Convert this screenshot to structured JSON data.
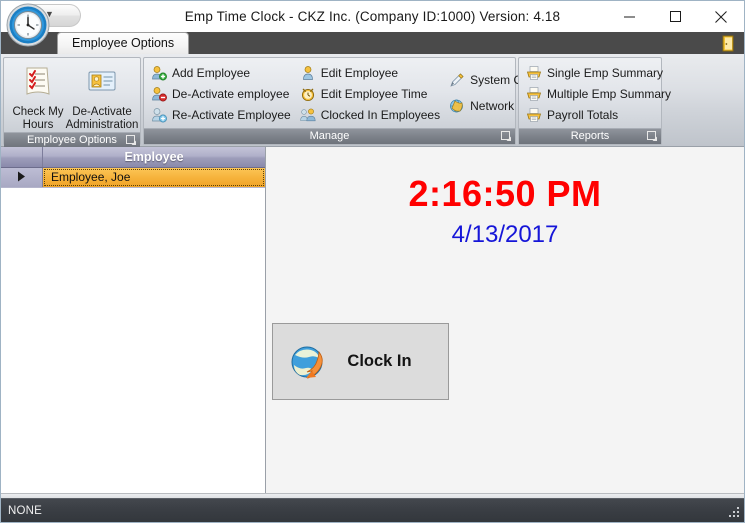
{
  "window": {
    "title": "Emp Time Clock - CKZ Inc. (Company ID:1000) Version: 4.18",
    "app_icon": "clock-icon",
    "quick_access_arrow": "chevron-down-icon",
    "minimize_label": "—",
    "maximize_label": "□",
    "close_label": "✕"
  },
  "ribbon": {
    "tabs": [
      {
        "label": "Employee Options",
        "active": true
      }
    ],
    "exit_icon": "door-exit-icon",
    "groups": [
      {
        "title": "Employee Options",
        "dialog_launcher": "dialog-launcher-icon",
        "big_buttons": [
          {
            "label": "Check My Hours",
            "icon": "checklist-icon"
          },
          {
            "label": "De-Activate Administration",
            "icon": "id-card-icon"
          }
        ],
        "items": []
      },
      {
        "title": "Manage",
        "dialog_launcher": "dialog-launcher-icon",
        "big_buttons": [],
        "columns": [
          [
            {
              "label": "Add Employee",
              "icon": "user-add-icon"
            },
            {
              "label": "De-Activate employee",
              "icon": "user-remove-icon"
            },
            {
              "label": "Re-Activate Employee",
              "icon": "user-restore-icon"
            }
          ],
          [
            {
              "label": "Edit Employee",
              "icon": "user-edit-icon"
            },
            {
              "label": "Edit Employee Time",
              "icon": "clock-edit-icon"
            },
            {
              "label": "Clocked In Employees",
              "icon": "users-group-icon"
            }
          ],
          [
            {
              "label": "System Options",
              "icon": "pencil-options-icon"
            },
            {
              "label": "Network Setup",
              "icon": "network-globe-icon"
            }
          ]
        ]
      },
      {
        "title": "Reports",
        "dialog_launcher": "dialog-launcher-icon",
        "big_buttons": [],
        "columns": [
          [
            {
              "label": "Single Emp Summary",
              "icon": "report-printer-icon"
            },
            {
              "label": "Multiple Emp Summary",
              "icon": "report-printer-icon"
            },
            {
              "label": "Payroll Totals",
              "icon": "report-printer-icon"
            }
          ]
        ]
      }
    ]
  },
  "employee_grid": {
    "indicator_icon": "row-selector-arrow-icon",
    "columns": [
      "Employee"
    ],
    "rows": [
      {
        "employee": "Employee, Joe",
        "selected": true
      }
    ]
  },
  "clock_panel": {
    "time": "2:16:50 PM",
    "date": "4/13/2017",
    "time_color": "#ff0000",
    "date_color": "#1515d8",
    "clock_button": {
      "label": "Clock In",
      "icon": "globe-arrow-icon"
    }
  },
  "status_bar": {
    "text": "NONE",
    "grip_icon": "resize-grip-icon"
  }
}
